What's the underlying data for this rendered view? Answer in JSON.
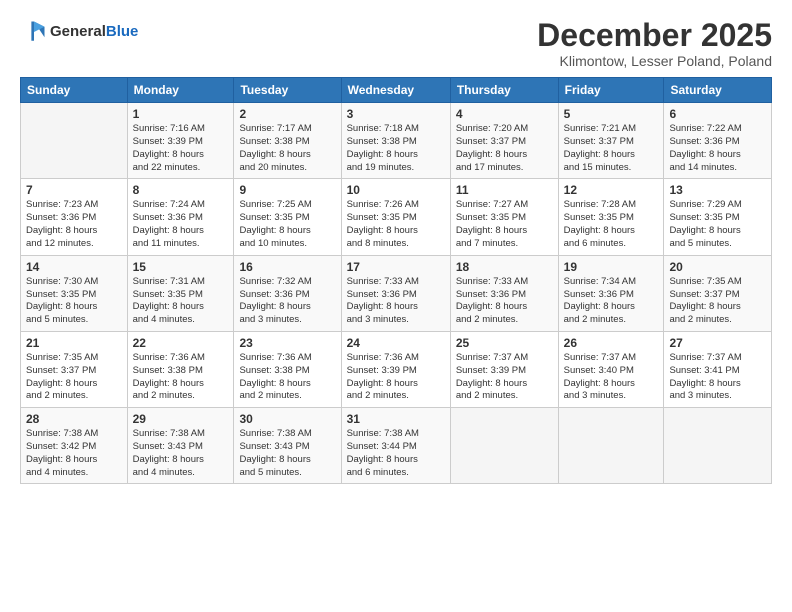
{
  "logo": {
    "general": "General",
    "blue": "Blue"
  },
  "header": {
    "title": "December 2025",
    "subtitle": "Klimontow, Lesser Poland, Poland"
  },
  "weekdays": [
    "Sunday",
    "Monday",
    "Tuesday",
    "Wednesday",
    "Thursday",
    "Friday",
    "Saturday"
  ],
  "weeks": [
    [
      {
        "date": "",
        "info": ""
      },
      {
        "date": "1",
        "info": "Sunrise: 7:16 AM\nSunset: 3:39 PM\nDaylight: 8 hours\nand 22 minutes."
      },
      {
        "date": "2",
        "info": "Sunrise: 7:17 AM\nSunset: 3:38 PM\nDaylight: 8 hours\nand 20 minutes."
      },
      {
        "date": "3",
        "info": "Sunrise: 7:18 AM\nSunset: 3:38 PM\nDaylight: 8 hours\nand 19 minutes."
      },
      {
        "date": "4",
        "info": "Sunrise: 7:20 AM\nSunset: 3:37 PM\nDaylight: 8 hours\nand 17 minutes."
      },
      {
        "date": "5",
        "info": "Sunrise: 7:21 AM\nSunset: 3:37 PM\nDaylight: 8 hours\nand 15 minutes."
      },
      {
        "date": "6",
        "info": "Sunrise: 7:22 AM\nSunset: 3:36 PM\nDaylight: 8 hours\nand 14 minutes."
      }
    ],
    [
      {
        "date": "7",
        "info": "Sunrise: 7:23 AM\nSunset: 3:36 PM\nDaylight: 8 hours\nand 12 minutes."
      },
      {
        "date": "8",
        "info": "Sunrise: 7:24 AM\nSunset: 3:36 PM\nDaylight: 8 hours\nand 11 minutes."
      },
      {
        "date": "9",
        "info": "Sunrise: 7:25 AM\nSunset: 3:35 PM\nDaylight: 8 hours\nand 10 minutes."
      },
      {
        "date": "10",
        "info": "Sunrise: 7:26 AM\nSunset: 3:35 PM\nDaylight: 8 hours\nand 8 minutes."
      },
      {
        "date": "11",
        "info": "Sunrise: 7:27 AM\nSunset: 3:35 PM\nDaylight: 8 hours\nand 7 minutes."
      },
      {
        "date": "12",
        "info": "Sunrise: 7:28 AM\nSunset: 3:35 PM\nDaylight: 8 hours\nand 6 minutes."
      },
      {
        "date": "13",
        "info": "Sunrise: 7:29 AM\nSunset: 3:35 PM\nDaylight: 8 hours\nand 5 minutes."
      }
    ],
    [
      {
        "date": "14",
        "info": "Sunrise: 7:30 AM\nSunset: 3:35 PM\nDaylight: 8 hours\nand 5 minutes."
      },
      {
        "date": "15",
        "info": "Sunrise: 7:31 AM\nSunset: 3:35 PM\nDaylight: 8 hours\nand 4 minutes."
      },
      {
        "date": "16",
        "info": "Sunrise: 7:32 AM\nSunset: 3:36 PM\nDaylight: 8 hours\nand 3 minutes."
      },
      {
        "date": "17",
        "info": "Sunrise: 7:33 AM\nSunset: 3:36 PM\nDaylight: 8 hours\nand 3 minutes."
      },
      {
        "date": "18",
        "info": "Sunrise: 7:33 AM\nSunset: 3:36 PM\nDaylight: 8 hours\nand 2 minutes."
      },
      {
        "date": "19",
        "info": "Sunrise: 7:34 AM\nSunset: 3:36 PM\nDaylight: 8 hours\nand 2 minutes."
      },
      {
        "date": "20",
        "info": "Sunrise: 7:35 AM\nSunset: 3:37 PM\nDaylight: 8 hours\nand 2 minutes."
      }
    ],
    [
      {
        "date": "21",
        "info": "Sunrise: 7:35 AM\nSunset: 3:37 PM\nDaylight: 8 hours\nand 2 minutes."
      },
      {
        "date": "22",
        "info": "Sunrise: 7:36 AM\nSunset: 3:38 PM\nDaylight: 8 hours\nand 2 minutes."
      },
      {
        "date": "23",
        "info": "Sunrise: 7:36 AM\nSunset: 3:38 PM\nDaylight: 8 hours\nand 2 minutes."
      },
      {
        "date": "24",
        "info": "Sunrise: 7:36 AM\nSunset: 3:39 PM\nDaylight: 8 hours\nand 2 minutes."
      },
      {
        "date": "25",
        "info": "Sunrise: 7:37 AM\nSunset: 3:39 PM\nDaylight: 8 hours\nand 2 minutes."
      },
      {
        "date": "26",
        "info": "Sunrise: 7:37 AM\nSunset: 3:40 PM\nDaylight: 8 hours\nand 3 minutes."
      },
      {
        "date": "27",
        "info": "Sunrise: 7:37 AM\nSunset: 3:41 PM\nDaylight: 8 hours\nand 3 minutes."
      }
    ],
    [
      {
        "date": "28",
        "info": "Sunrise: 7:38 AM\nSunset: 3:42 PM\nDaylight: 8 hours\nand 4 minutes."
      },
      {
        "date": "29",
        "info": "Sunrise: 7:38 AM\nSunset: 3:43 PM\nDaylight: 8 hours\nand 4 minutes."
      },
      {
        "date": "30",
        "info": "Sunrise: 7:38 AM\nSunset: 3:43 PM\nDaylight: 8 hours\nand 5 minutes."
      },
      {
        "date": "31",
        "info": "Sunrise: 7:38 AM\nSunset: 3:44 PM\nDaylight: 8 hours\nand 6 minutes."
      },
      {
        "date": "",
        "info": ""
      },
      {
        "date": "",
        "info": ""
      },
      {
        "date": "",
        "info": ""
      }
    ]
  ]
}
